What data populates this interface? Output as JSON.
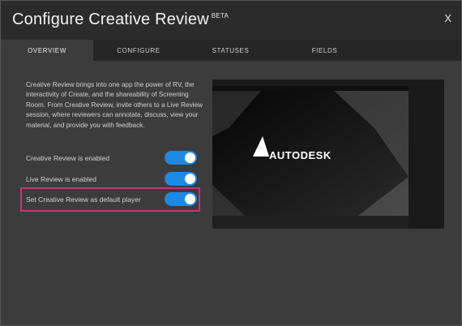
{
  "dialog": {
    "title": "Configure Creative Review",
    "title_badge": "BETA",
    "close_label": "X"
  },
  "tabs": [
    {
      "label": "OVERVIEW",
      "active": true
    },
    {
      "label": "CONFIGURE",
      "active": false
    },
    {
      "label": "STATUSES",
      "active": false
    },
    {
      "label": "FIELDS",
      "active": false
    }
  ],
  "overview": {
    "description": "Creative Review brings into one app the power of RV, the interactivity of Create, and the shareability of Screening Room. From Creative Review, invite others to a Live Review session, where reviewers can annotate, discuss, view your material, and provide you with feedback.",
    "settings": [
      {
        "label": "Creative Review is enabled",
        "enabled": true
      },
      {
        "label": "Live Review is enabled",
        "enabled": true
      },
      {
        "label": "Set Creative Review as default player",
        "enabled": true,
        "highlighted": true
      }
    ]
  },
  "preview": {
    "logo_text": "AUTODESK"
  },
  "colors": {
    "toggle_on": "#1e88e5",
    "highlight_border": "#c0357a",
    "titlebar": "#2b2b2b",
    "panel": "#3c3c3c"
  }
}
